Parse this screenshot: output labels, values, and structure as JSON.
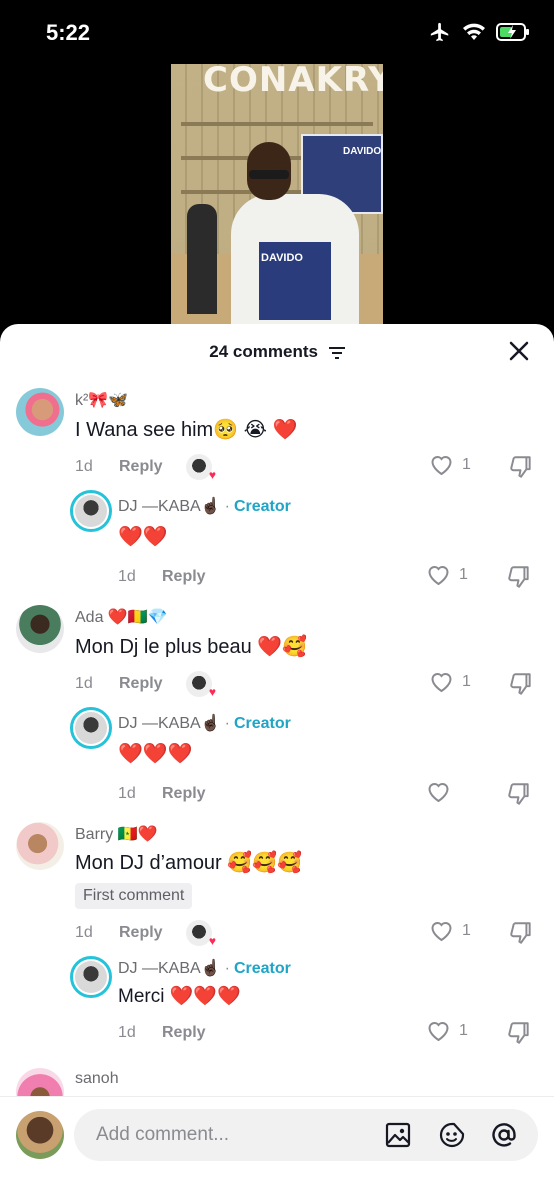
{
  "status": {
    "time": "5:22"
  },
  "video": {
    "banner": "CONAKRY",
    "shirt": "DAVIDO",
    "billboard": "DAVIDO"
  },
  "sheet": {
    "title": "24 comments"
  },
  "comments": [
    {
      "user": "k²🎀🦋",
      "text": "I Wana see him🥺 😭 ❤️",
      "date": "1d",
      "reply": "Reply",
      "likes": "1",
      "reply_item": {
        "user": "DJ —KABA☝🏿",
        "tag": "Creator",
        "text": "❤️❤️",
        "date": "1d",
        "reply": "Reply",
        "likes": "1"
      }
    },
    {
      "user": "Ada ❤️🇬🇳💎",
      "text": "Mon Dj le plus beau ❤️🥰",
      "date": "1d",
      "reply": "Reply",
      "likes": "1",
      "reply_item": {
        "user": "DJ —KABA☝🏿",
        "tag": "Creator",
        "text": "❤️❤️❤️",
        "date": "1d",
        "reply": "Reply",
        "likes": ""
      }
    },
    {
      "user": "Barry 🇸🇳❤️",
      "text": "Mon DJ d’amour 🥰🥰🥰",
      "badge": "First comment",
      "date": "1d",
      "reply": "Reply",
      "likes": "1",
      "reply_item": {
        "user": "DJ —KABA☝🏿",
        "tag": "Creator",
        "text": "Merci ❤️❤️❤️",
        "date": "1d",
        "reply": "Reply",
        "likes": "1"
      }
    },
    {
      "user": "sanoh"
    }
  ],
  "composer": {
    "placeholder": "Add comment..."
  }
}
